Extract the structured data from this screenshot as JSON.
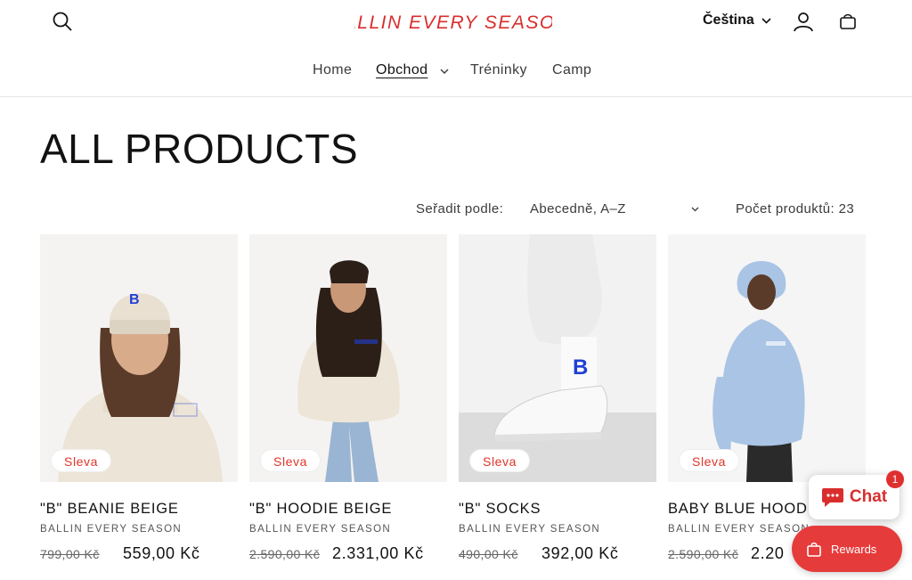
{
  "header": {
    "logo_text": "BALLIN EVERY SEASON.",
    "language": "Čeština",
    "icons": {
      "search": "search-icon",
      "account": "account-icon",
      "cart": "cart-icon"
    }
  },
  "nav": {
    "home": "Home",
    "shop": "Obchod",
    "trainings": "Tréninky",
    "camp": "Camp"
  },
  "page": {
    "title": "ALL PRODUCTS",
    "sort_label": "Seřadit podle:",
    "sort_value": "Abecedně, A–Z",
    "product_count": "Počet produktů: 23"
  },
  "products": [
    {
      "title": "\"B\" BEANIE BEIGE",
      "vendor": "BALLIN EVERY SEASON",
      "old_price": "799,00 Kč",
      "price": "559,00 Kč",
      "badge": "Sleva"
    },
    {
      "title": "\"B\" HOODIE BEIGE",
      "vendor": "BALLIN EVERY SEASON",
      "old_price": "2.590,00 Kč",
      "price": "2.331,00 Kč",
      "badge": "Sleva"
    },
    {
      "title": "\"B\" SOCKS",
      "vendor": "BALLIN EVERY SEASON",
      "old_price": "490,00 Kč",
      "price": "392,00 Kč",
      "badge": "Sleva"
    },
    {
      "title": "BABY BLUE HOOD",
      "vendor": "BALLIN EVERY SEASON",
      "old_price": "2.590,00 Kč",
      "price": "2.20",
      "badge": "Sleva"
    }
  ],
  "widgets": {
    "chat_label": "Chat",
    "chat_badge": "1",
    "rewards_label": "Rewards"
  },
  "colors": {
    "brand_red": "#e03428",
    "logo_red": "#d92e2e",
    "accent_blue": "#1f3fd6",
    "hoodie_blue": "#a9c4e4"
  }
}
